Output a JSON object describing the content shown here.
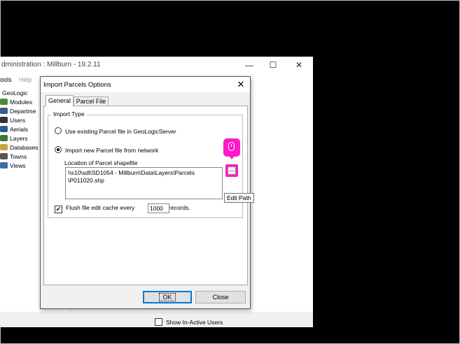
{
  "app": {
    "title": "dministration : Millburn - 19.2.11",
    "window_controls": {
      "minimize": "—",
      "maximize": "☐",
      "close": "✕"
    },
    "menu": [
      "ools",
      "Help"
    ],
    "tree": {
      "root": "GeoLogic",
      "items": [
        {
          "label": "Modules",
          "icon": "modules-icon",
          "color": "#4a8a3a"
        },
        {
          "label": "Departme",
          "icon": "department-icon",
          "color": "#3d5a8a"
        },
        {
          "label": "Users",
          "icon": "users-icon",
          "color": "#333333"
        },
        {
          "label": "Aerials",
          "icon": "aerials-icon",
          "color": "#2a5a9a"
        },
        {
          "label": "Layers",
          "icon": "layers-icon",
          "color": "#3a7a3a"
        },
        {
          "label": "Databases",
          "icon": "database-icon",
          "color": "#c8a640"
        },
        {
          "label": "Towns",
          "icon": "towns-icon",
          "color": "#555555"
        },
        {
          "label": "Views",
          "icon": "views-icon",
          "color": "#3a6aa8"
        }
      ]
    },
    "show_inactive_label": "Show In-Active Users"
  },
  "dialog": {
    "title": "Import Parcels Options",
    "close_glyph": "✕",
    "tabs": [
      "General",
      "Parcel File"
    ],
    "group_label": "Import Type",
    "option_existing": "Use existing Parcel file in GeoLogicServer",
    "option_network": "Import new Parcel file from network",
    "location_label": "Location of Parcel shapefile",
    "path_value": "\\\\s10\\sdl\\SD1054 - Millburn\\Data\\Layers\\Parcels\n\\P011020.shp",
    "edit_button_glyph": "...",
    "edit_tooltip": "Edit Path",
    "flush_prefix": "Flush file edit cache every",
    "flush_value": "1000",
    "flush_suffix": "records.",
    "flush_checked": "✔",
    "ok_label": "OK",
    "close_label": "Close"
  },
  "colors": {
    "accent": "#ff19c8",
    "focus": "#0078d7"
  }
}
